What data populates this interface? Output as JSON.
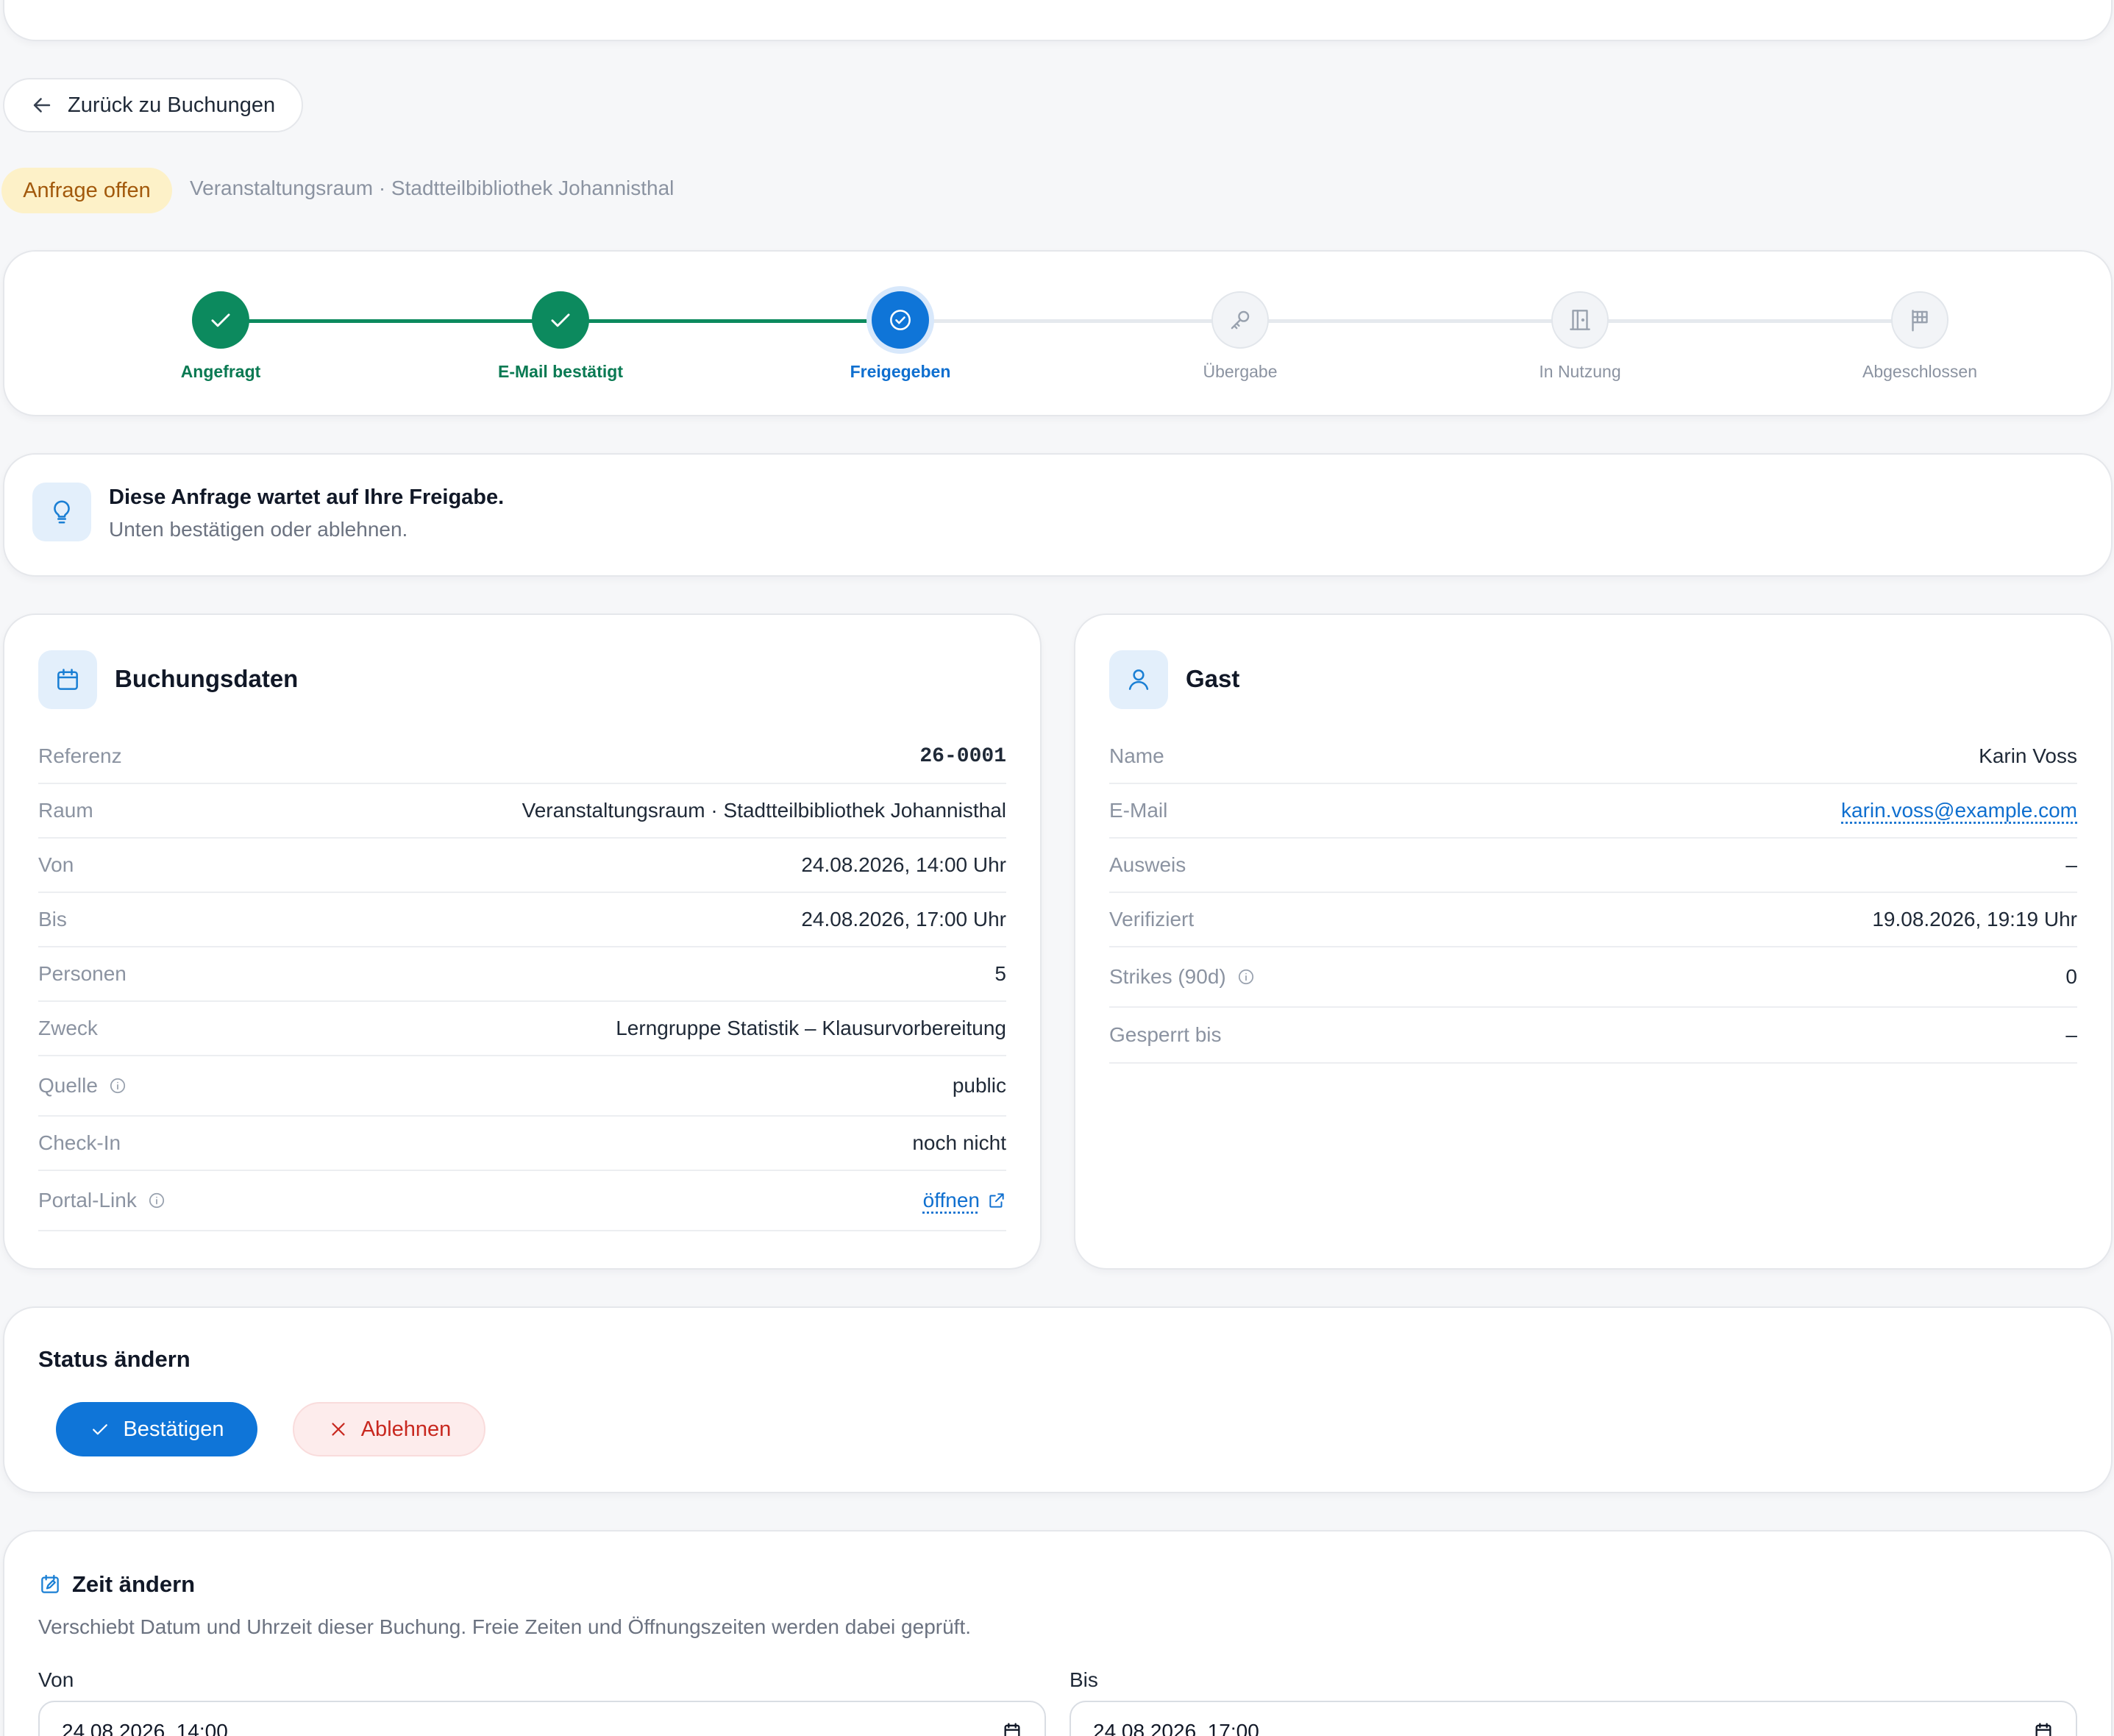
{
  "nav": {
    "back_label": "Zurück zu Buchungen"
  },
  "header": {
    "status_badge": "Anfrage offen",
    "room": "Veranstaltungsraum · Stadtteilbibliothek Johannisthal"
  },
  "stepper": {
    "steps": [
      {
        "label": "Angefragt",
        "state": "done",
        "icon": "check-icon"
      },
      {
        "label": "E-Mail bestätigt",
        "state": "done",
        "icon": "check-icon"
      },
      {
        "label": "Freigegeben",
        "state": "current",
        "icon": "check-circle-icon"
      },
      {
        "label": "Übergabe",
        "state": "pending",
        "icon": "key-icon"
      },
      {
        "label": "In Nutzung",
        "state": "pending",
        "icon": "door-icon"
      },
      {
        "label": "Abgeschlossen",
        "state": "pending",
        "icon": "flag-icon"
      }
    ]
  },
  "info": {
    "title": "Diese Anfrage wartet auf Ihre Freigabe.",
    "subtitle": "Unten bestätigen oder ablehnen.",
    "icon": "lightbulb-icon"
  },
  "booking": {
    "title": "Buchungsdaten",
    "icon": "calendar-icon",
    "rows": [
      {
        "label": "Referenz",
        "value": "26-0001"
      },
      {
        "label": "Raum",
        "value": "Veranstaltungsraum · Stadtteilbibliothek Johannisthal"
      },
      {
        "label": "Von",
        "value": "24.08.2026, 14:00 Uhr"
      },
      {
        "label": "Bis",
        "value": "24.08.2026, 17:00 Uhr"
      },
      {
        "label": "Personen",
        "value": "5"
      },
      {
        "label": "Zweck",
        "value": "Lerngruppe Statistik – Klausurvorbereitung"
      },
      {
        "label": "Quelle",
        "value": "public"
      },
      {
        "label": "Check-In",
        "value": "noch nicht"
      },
      {
        "label": "Portal-Link",
        "value": "öffnen"
      }
    ]
  },
  "guest": {
    "title": "Gast",
    "icon": "user-icon",
    "rows": [
      {
        "label": "Name",
        "value": "Karin Voss"
      },
      {
        "label": "E-Mail",
        "value": "karin.voss@example.com"
      },
      {
        "label": "Ausweis",
        "value": "–"
      },
      {
        "label": "Verifiziert",
        "value": "19.08.2026, 19:19 Uhr"
      },
      {
        "label": "Strikes (90d)",
        "value": "0"
      },
      {
        "label": "Gesperrt bis",
        "value": "–"
      }
    ]
  },
  "status_change": {
    "title": "Status ändern",
    "confirm_label": "Bestätigen",
    "reject_label": "Ablehnen"
  },
  "time_change": {
    "title": "Zeit ändern",
    "description": "Verschiebt Datum und Uhrzeit dieser Buchung. Freie Zeiten und Öffnungszeiten werden dabei geprüft.",
    "from_label": "Von",
    "from_value": "24.08.2026, 14:00",
    "to_label": "Bis",
    "to_value": "24.08.2026, 17:00"
  },
  "colors": {
    "primary": "#0f75d8",
    "success": "#0c8a5e",
    "danger": "#c8281f",
    "warning_bg": "#fdf1c8",
    "warning_text": "#a2590c"
  }
}
